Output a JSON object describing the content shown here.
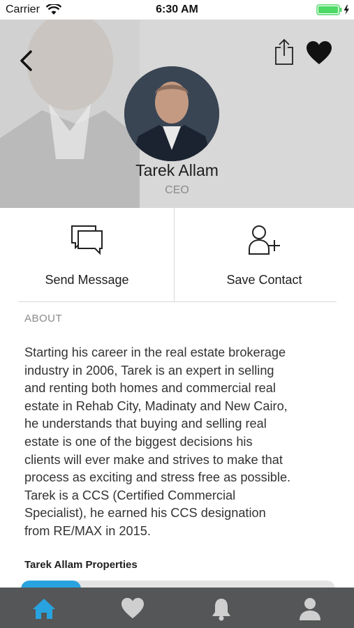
{
  "status_bar": {
    "carrier": "Carrier",
    "time": "6:30 AM",
    "battery_color": "#4cd964"
  },
  "header": {
    "back_icon": "chevron-left-icon",
    "share_icon": "share-icon",
    "favorite_icon": "heart-icon",
    "name": "Tarek Allam",
    "title": "CEO"
  },
  "actions": [
    {
      "label": "Send Message",
      "icon": "message-icon"
    },
    {
      "label": "Save Contact",
      "icon": "add-contact-icon"
    }
  ],
  "about": {
    "heading": "ABOUT",
    "lines": [
      "Starting his career in the real estate brokerage",
      "industry in 2006, Tarek  is an expert in selling",
      "and renting both homes and commercial real",
      "estate in Rehab City, Madinaty and New Cairo,",
      "he understands that buying and selling real",
      "estate is one of the biggest decisions his",
      "clients will ever make and strives to make that",
      "process as exciting and stress free as possible.",
      "Tarek is a CCS (Certified Commercial",
      "Specialist), he earned his CCS designation",
      "from RE/MAX in 2015."
    ]
  },
  "properties": {
    "heading": "Tarek Allam Properties"
  },
  "tabbar": {
    "tabs": [
      {
        "icon": "home-icon",
        "active": true
      },
      {
        "icon": "heart-icon",
        "active": false
      },
      {
        "icon": "bell-icon",
        "active": false
      },
      {
        "icon": "profile-icon",
        "active": false
      }
    ],
    "active_color": "#29a3df",
    "inactive_color": "#cfcfcf",
    "background": "#555657"
  }
}
